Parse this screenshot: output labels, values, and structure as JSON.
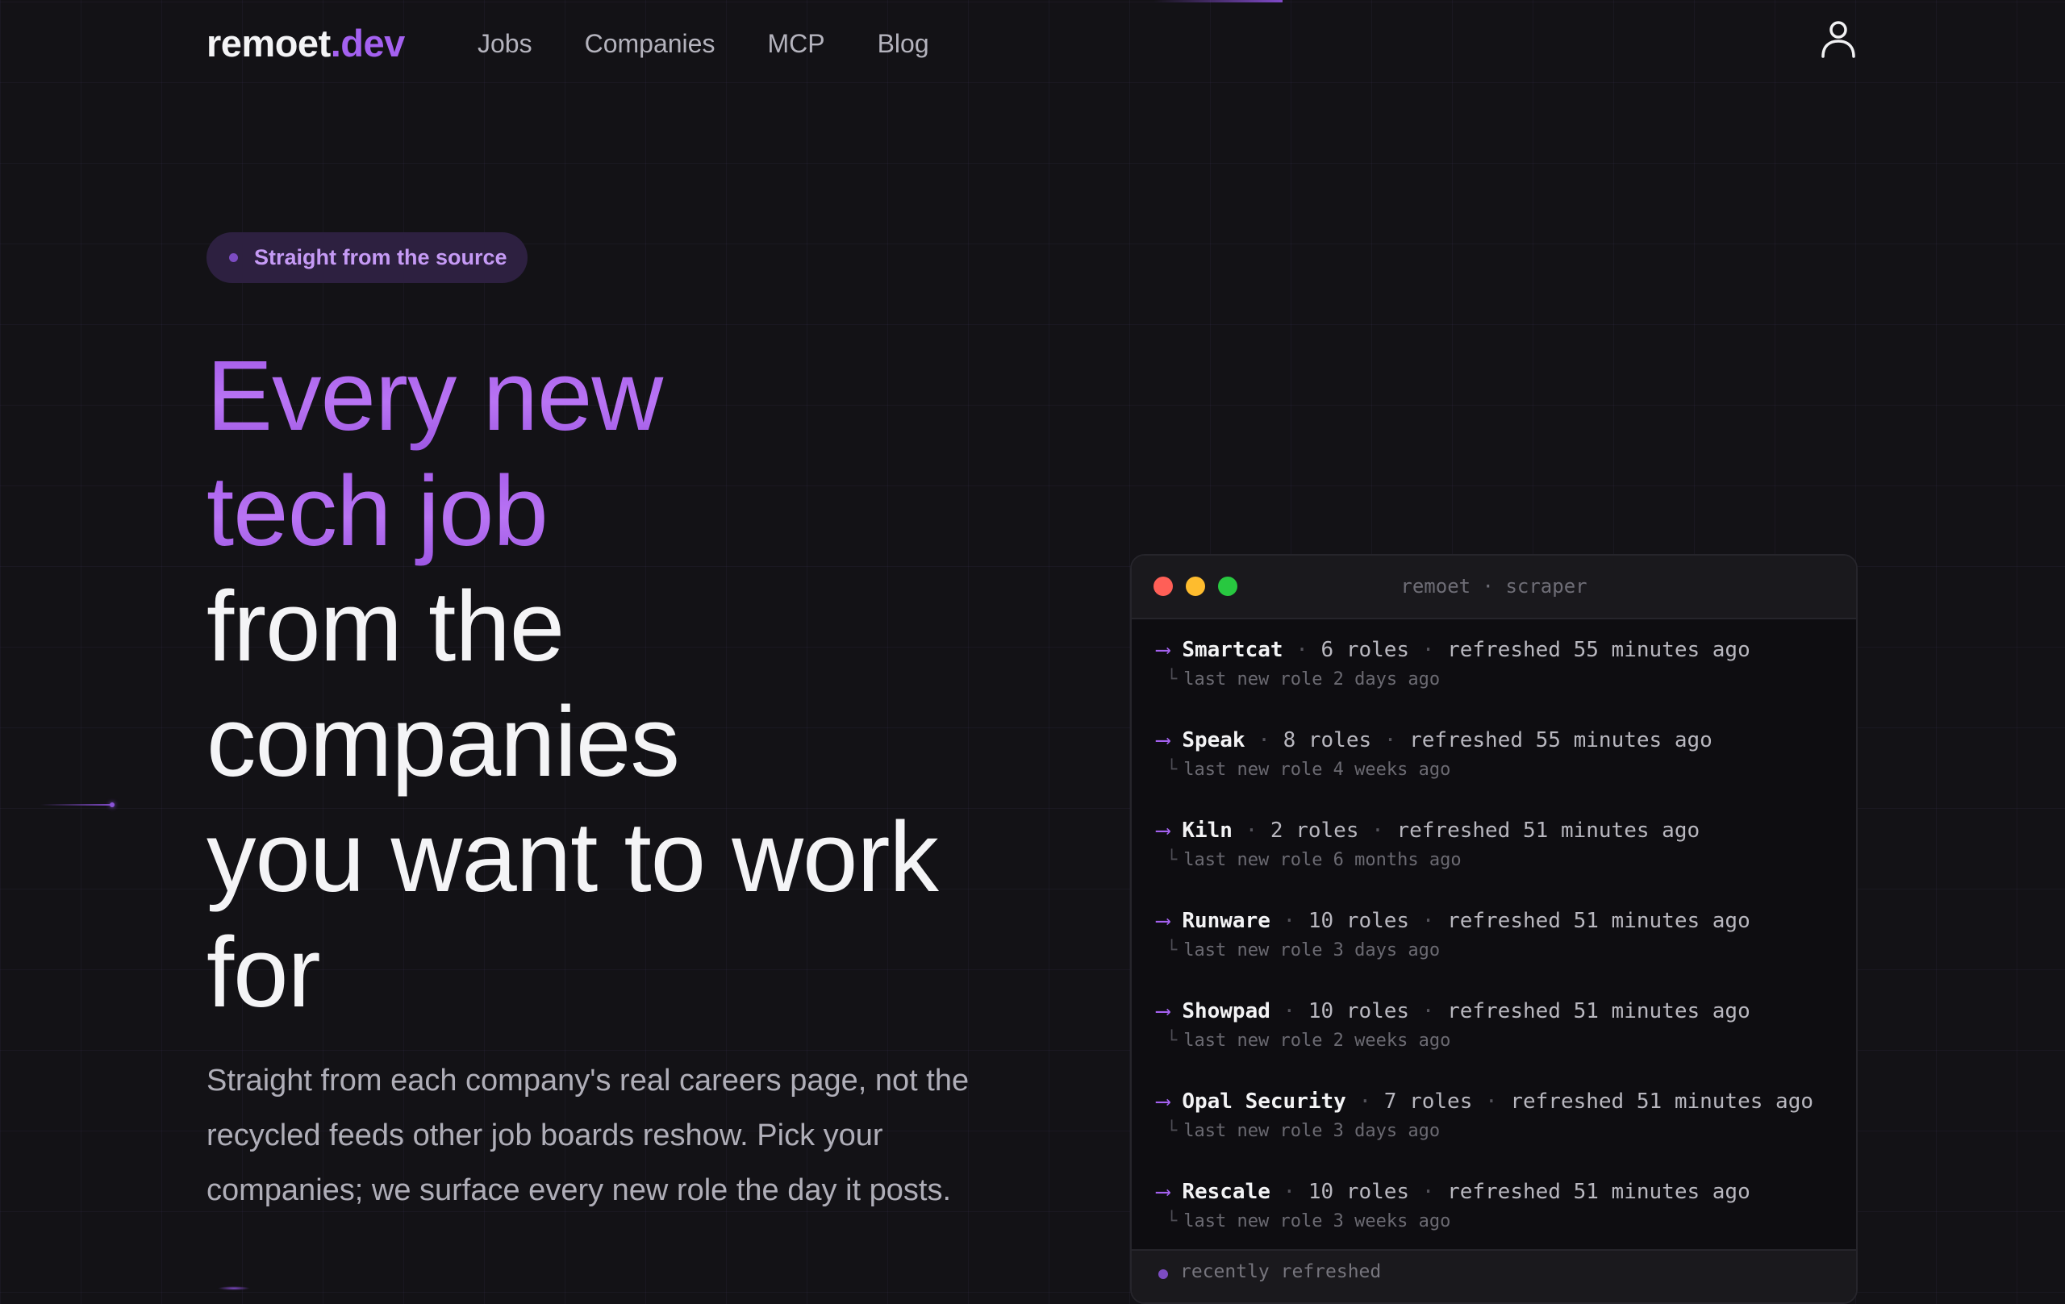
{
  "brand": {
    "name_main": "remoet",
    "name_tld": ".dev",
    "accent_color": "#a461f0"
  },
  "nav": {
    "links": [
      "Jobs",
      "Companies",
      "MCP",
      "Blog"
    ],
    "account_icon": "user-icon"
  },
  "hero": {
    "badge": "Straight from the source",
    "headline_accent_lines": [
      "Every new",
      "tech job"
    ],
    "headline_lines": [
      "from the",
      "companies",
      "you want to work",
      "for"
    ],
    "subtext": "Straight from each company's real careers page, not the recycled feeds other job boards reshow. Pick your companies; we surface every new role the day it posts."
  },
  "terminal": {
    "title": "remoet · scraper",
    "arrow": "⟶",
    "separator": "·",
    "elbow": "└",
    "entries": [
      {
        "company": "Smartcat",
        "roles": "6 roles",
        "refreshed": "refreshed 55 minutes ago",
        "last_new": "last new role 2 days ago"
      },
      {
        "company": "Speak",
        "roles": "8 roles",
        "refreshed": "refreshed 55 minutes ago",
        "last_new": "last new role 4 weeks ago"
      },
      {
        "company": "Kiln",
        "roles": "2 roles",
        "refreshed": "refreshed 51 minutes ago",
        "last_new": "last new role 6 months ago"
      },
      {
        "company": "Runware",
        "roles": "10 roles",
        "refreshed": "refreshed 51 minutes ago",
        "last_new": "last new role 3 days ago"
      },
      {
        "company": "Showpad",
        "roles": "10 roles",
        "refreshed": "refreshed 51 minutes ago",
        "last_new": "last new role 2 weeks ago"
      },
      {
        "company": "Opal Security",
        "roles": "7 roles",
        "refreshed": "refreshed 51 minutes ago",
        "last_new": "last new role 3 days ago"
      },
      {
        "company": "Rescale",
        "roles": "10 roles",
        "refreshed": "refreshed 51 minutes ago",
        "last_new": "last new role 3 weeks ago"
      }
    ],
    "footer": "recently refreshed"
  }
}
